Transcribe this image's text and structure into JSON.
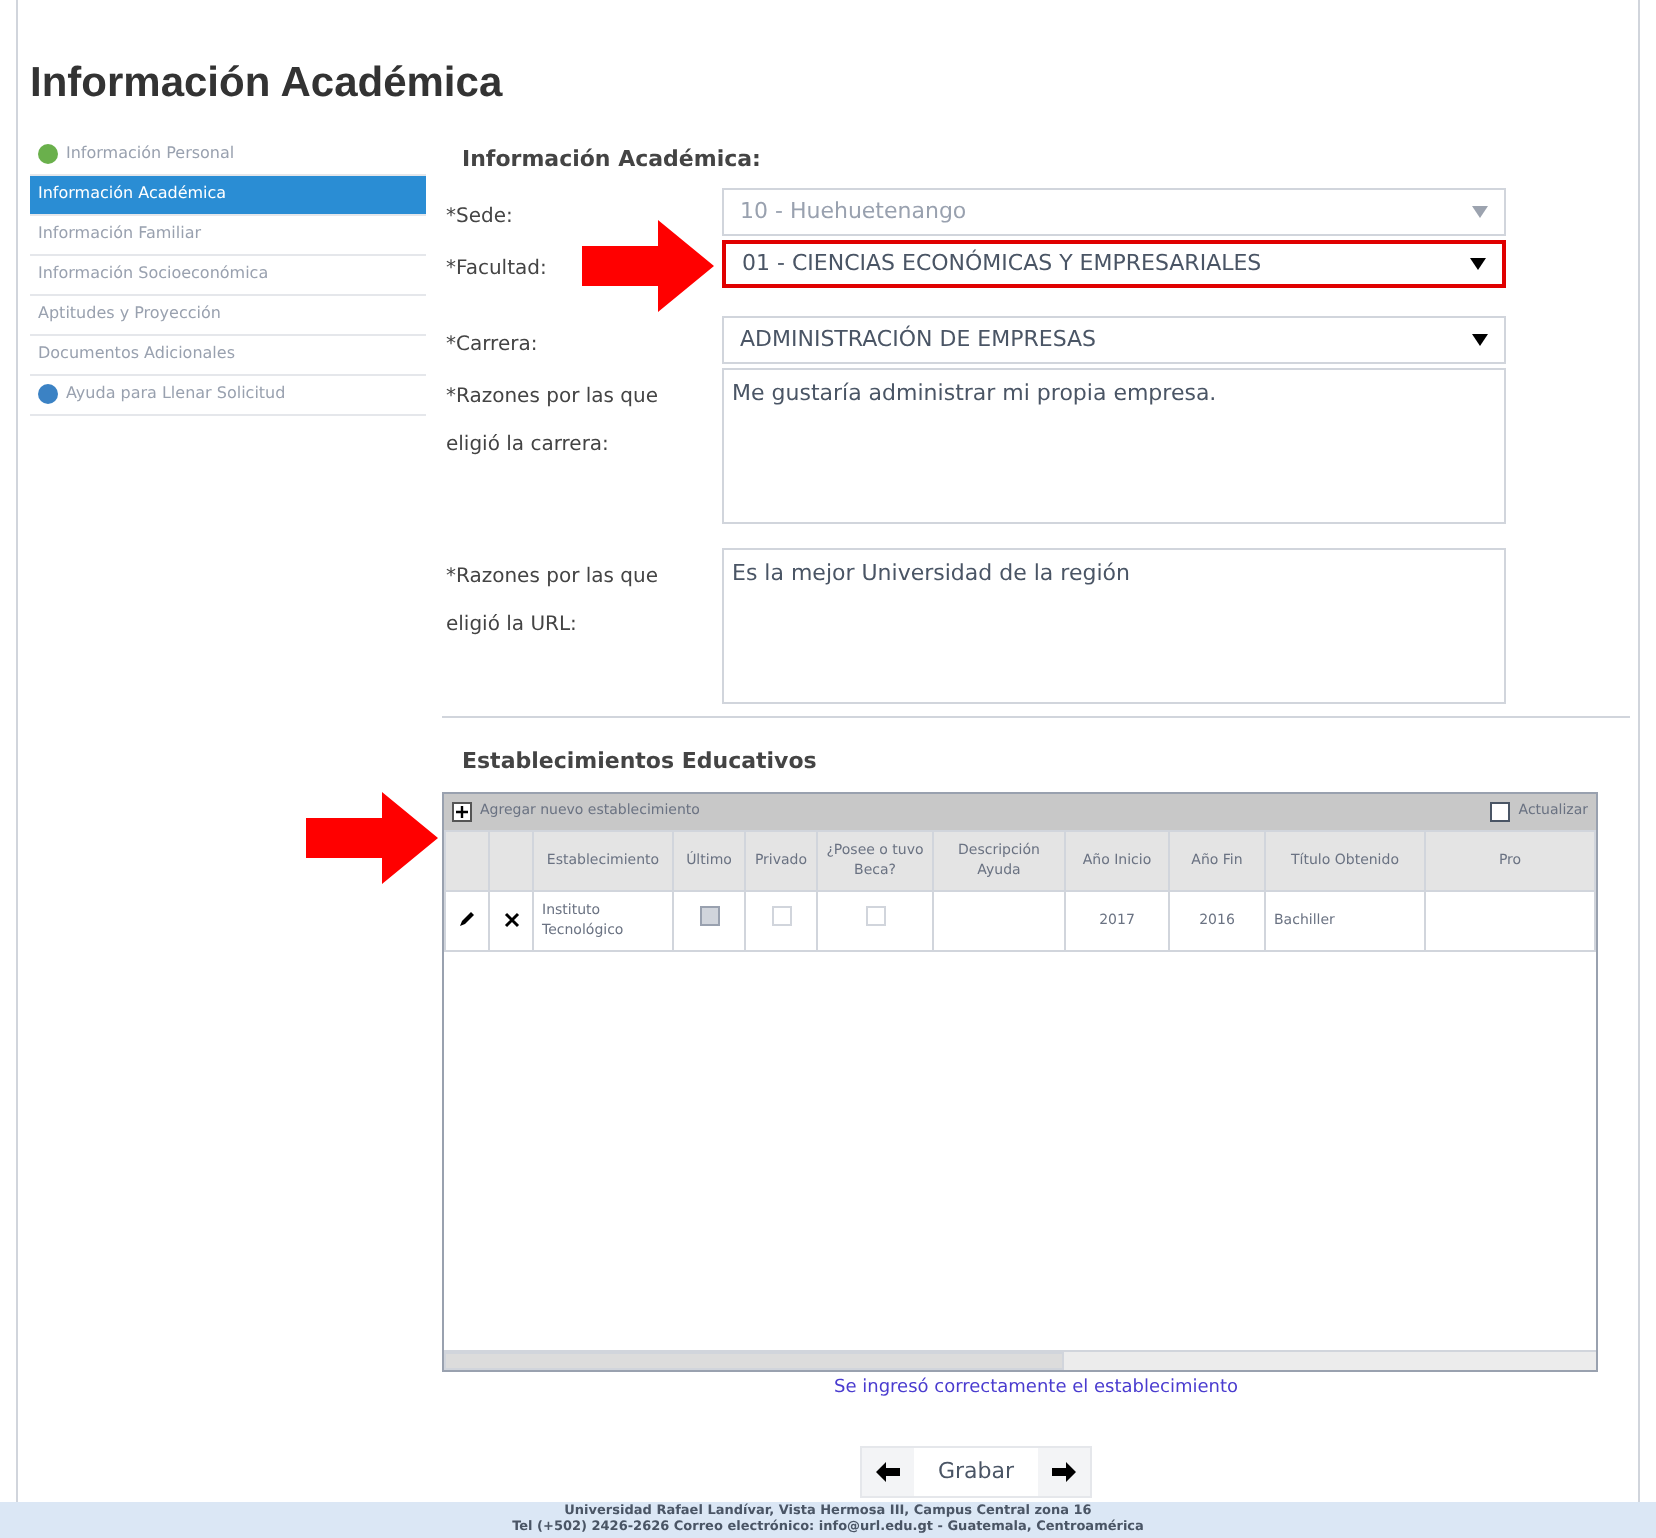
{
  "page_title": "Información Académica",
  "sidebar": {
    "items": [
      {
        "label": "Información Personal",
        "selected": false,
        "kind": "done"
      },
      {
        "label": "Información Académica",
        "selected": true,
        "kind": "plain"
      },
      {
        "label": "Información Familiar",
        "selected": false,
        "kind": "plain"
      },
      {
        "label": "Información Socioeconómica",
        "selected": false,
        "kind": "plain"
      },
      {
        "label": "Aptitudes y Proyección",
        "selected": false,
        "kind": "plain"
      },
      {
        "label": "Documentos Adicionales",
        "selected": false,
        "kind": "plain"
      },
      {
        "label": "Ayuda para Llenar Solicitud",
        "selected": false,
        "kind": "help"
      }
    ]
  },
  "form": {
    "title": "Información Académica:",
    "fields": [
      {
        "label": "*Sede:",
        "value": "10 - Huehuetenango",
        "kind": "select",
        "disabled": true,
        "highlighted": false
      },
      {
        "label": "*Facultad:",
        "value": "01 - CIENCIAS ECONÓMICAS Y EMPRESARIALES",
        "kind": "select",
        "disabled": false,
        "highlighted": true
      },
      {
        "label": "*Carrera:",
        "value": "ADMINISTRACIÓN DE EMPRESAS",
        "kind": "select",
        "disabled": false,
        "highlighted": false
      },
      {
        "label": "*Razones por las que eligió la carrera:",
        "value": "Me gustaría administrar mi propia empresa.",
        "kind": "textarea",
        "disabled": false,
        "highlighted": false
      },
      {
        "label": "*Razones por las que eligió la URL:",
        "value": "Es la mejor Universidad de la región",
        "kind": "textarea",
        "disabled": false,
        "highlighted": false
      }
    ]
  },
  "establishments": {
    "title": "Establecimientos Educativos",
    "add_label": "Agregar nuevo establecimiento",
    "refresh_label": "Actualizar",
    "columns": [
      "Establecimiento",
      "Último",
      "Privado",
      "¿Posee o tuvo Beca?",
      "Descripción Ayuda",
      "Año Inicio",
      "Año Fin",
      "Título Obtenido",
      "Pro"
    ],
    "rows": [
      {
        "establecimiento": "Instituto Tecnológico",
        "ultimo": true,
        "privado": false,
        "beca": false,
        "descripcion": "",
        "inicio": "2017",
        "fin": "2016",
        "titulo": "Bachiller"
      }
    ]
  },
  "message": "Se ingresó correctamente el establecimiento",
  "save_label": "Grabar",
  "footer": [
    "Universidad Rafael Landívar, Vista Hermosa III, Campus Central zona 16",
    "Tel (+502) 2426-2626 Correo electrónico: info@url.edu.gt - Guatemala, Centroamérica"
  ]
}
